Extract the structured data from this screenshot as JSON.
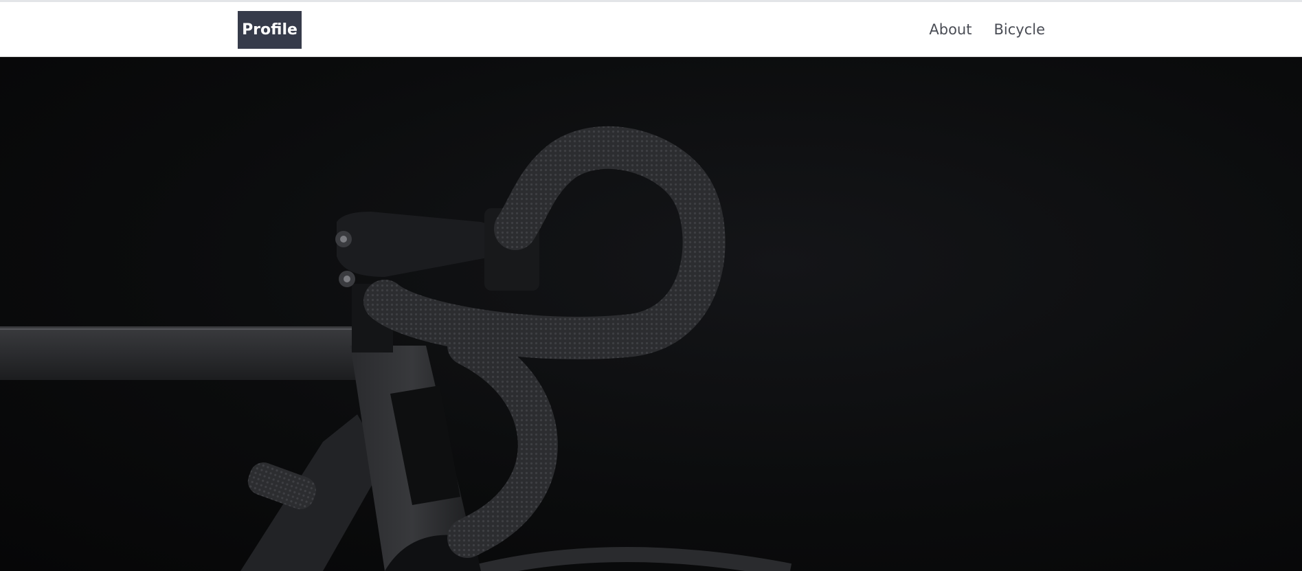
{
  "navbar": {
    "brand_label": "Profile",
    "links": [
      {
        "label": "About"
      },
      {
        "label": "Bicycle"
      }
    ]
  },
  "hero": {
    "image": "bicycle-handlebar-photo",
    "background_color": "#0b0c0d"
  },
  "colors": {
    "brand_bg": "#363b4a",
    "brand_text": "#ffffff",
    "nav_text": "#4a4d55"
  }
}
